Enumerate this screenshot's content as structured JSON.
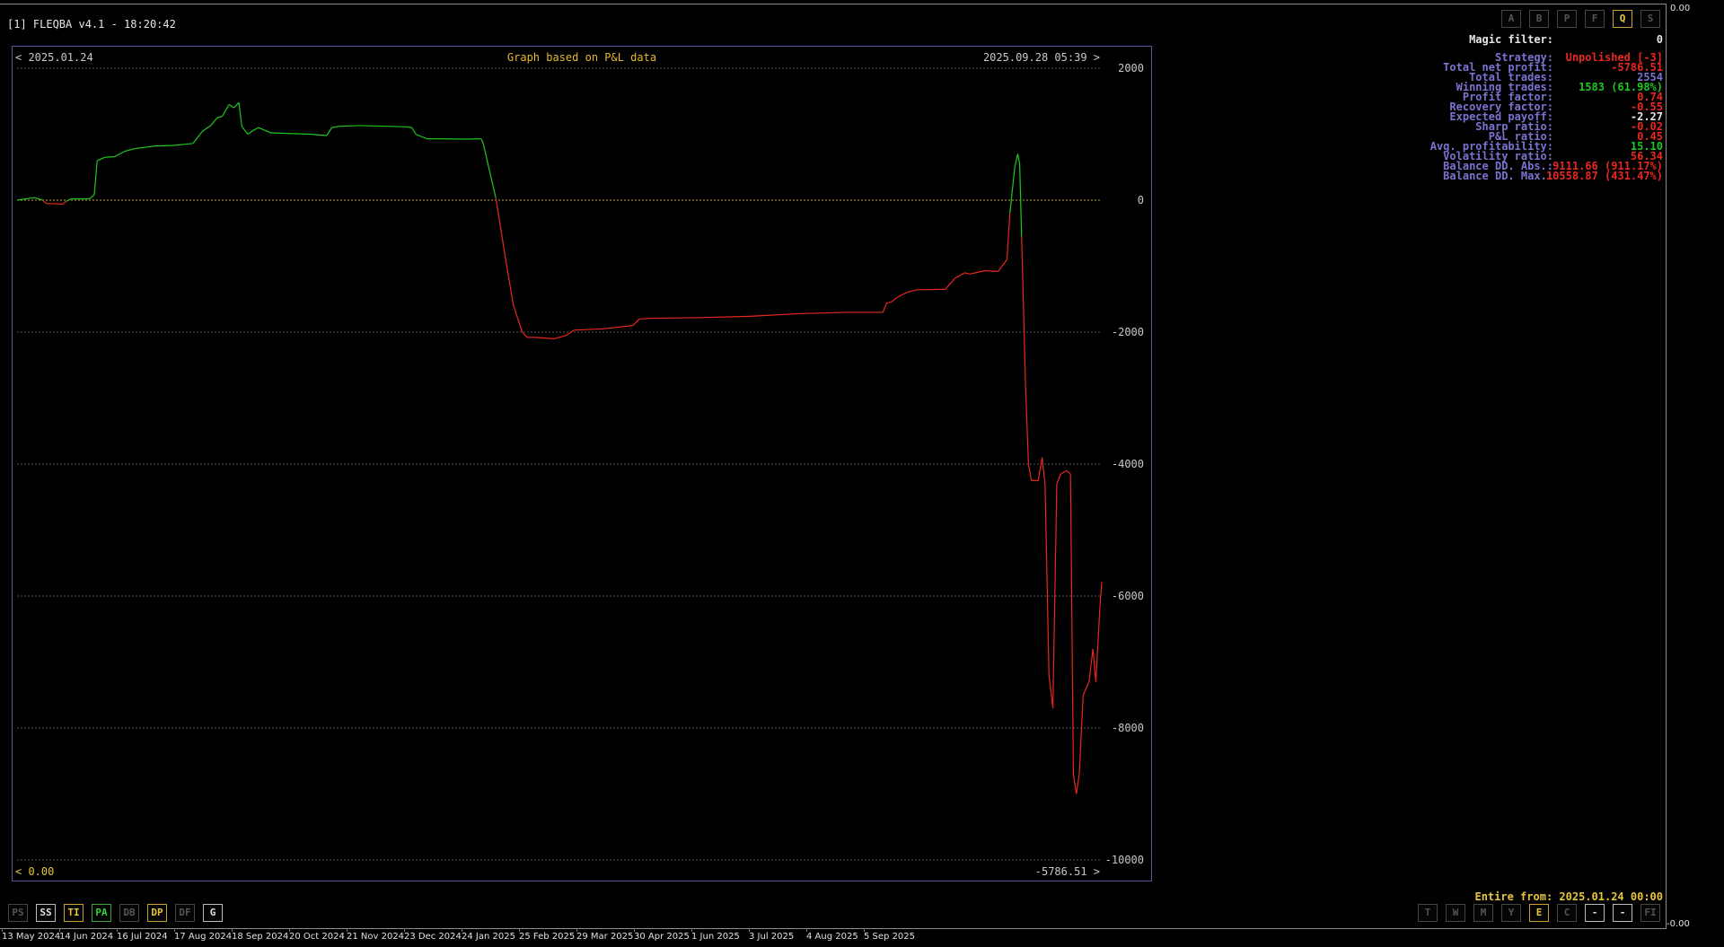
{
  "window": {
    "title": "[1] FLEQBA v4.1 - 18:20:42"
  },
  "chart_frame": {
    "start_date": "< 2025.01.24",
    "subtitle": "Graph based on P&L data",
    "end_date": "2025.09.28 05:39 >",
    "bottom_left": "< 0.00",
    "bottom_right": "-5786.51 >"
  },
  "chart_data": {
    "type": "line",
    "title": "Graph based on P&L data",
    "xlabel": "",
    "ylabel": "",
    "ylim": [
      -10000,
      2000
    ],
    "yticks": [
      2000,
      0,
      -2000,
      -4000,
      -6000,
      -8000,
      -10000
    ],
    "ytick_labels": [
      "2000",
      "0",
      "-2000",
      "-4000",
      "-6000",
      "-8000",
      "-10000"
    ],
    "grid": true,
    "positive_color": "#1ec81e",
    "negative_color": "#e8281e",
    "series": [
      {
        "values": [
          [
            0,
            0
          ],
          [
            18,
            40
          ],
          [
            26,
            0
          ],
          [
            30,
            -50
          ],
          [
            47,
            -60
          ],
          [
            50,
            -20
          ],
          [
            55,
            20
          ],
          [
            74,
            20
          ],
          [
            79,
            80
          ],
          [
            82,
            600
          ],
          [
            90,
            650
          ],
          [
            100,
            660
          ],
          [
            110,
            740
          ],
          [
            120,
            780
          ],
          [
            140,
            820
          ],
          [
            160,
            830
          ],
          [
            180,
            860
          ],
          [
            190,
            1050
          ],
          [
            198,
            1130
          ],
          [
            205,
            1250
          ],
          [
            210,
            1270
          ],
          [
            217,
            1450
          ],
          [
            222,
            1400
          ],
          [
            227,
            1480
          ],
          [
            230,
            1120
          ],
          [
            236,
            1000
          ],
          [
            241,
            1050
          ],
          [
            247,
            1100
          ],
          [
            260,
            1020
          ],
          [
            280,
            1010
          ],
          [
            300,
            1000
          ],
          [
            317,
            980
          ],
          [
            322,
            1100
          ],
          [
            330,
            1120
          ],
          [
            350,
            1130
          ],
          [
            380,
            1120
          ],
          [
            400,
            1110
          ],
          [
            404,
            1100
          ],
          [
            408,
            1000
          ],
          [
            416,
            950
          ],
          [
            420,
            930
          ],
          [
            430,
            930
          ],
          [
            460,
            925
          ],
          [
            475,
            930
          ],
          [
            477,
            860
          ],
          [
            490,
            30
          ],
          [
            500,
            -900
          ],
          [
            508,
            -1600
          ],
          [
            517,
            -2000
          ],
          [
            522,
            -2080
          ],
          [
            530,
            -2080
          ],
          [
            550,
            -2100
          ],
          [
            562,
            -2050
          ],
          [
            570,
            -1970
          ],
          [
            600,
            -1950
          ],
          [
            630,
            -1900
          ],
          [
            637,
            -1800
          ],
          [
            650,
            -1790
          ],
          [
            700,
            -1780
          ],
          [
            750,
            -1760
          ],
          [
            800,
            -1720
          ],
          [
            850,
            -1700
          ],
          [
            886,
            -1700
          ],
          [
            890,
            -1560
          ],
          [
            895,
            -1540
          ],
          [
            900,
            -1480
          ],
          [
            910,
            -1400
          ],
          [
            920,
            -1360
          ],
          [
            950,
            -1350
          ],
          [
            960,
            -1180
          ],
          [
            970,
            -1100
          ],
          [
            975,
            -1120
          ],
          [
            990,
            -1070
          ],
          [
            1004,
            -1080
          ],
          [
            1008,
            -1000
          ],
          [
            1013,
            -900
          ],
          [
            1016,
            -200
          ],
          [
            1021,
            500
          ],
          [
            1024,
            700
          ],
          [
            1026,
            550
          ],
          [
            1028,
            -550
          ],
          [
            1032,
            -2800
          ],
          [
            1035,
            -4000
          ],
          [
            1038,
            -4250
          ],
          [
            1045,
            -4250
          ],
          [
            1049,
            -3900
          ],
          [
            1052,
            -4300
          ],
          [
            1056,
            -7200
          ],
          [
            1060,
            -7700
          ],
          [
            1064,
            -4300
          ],
          [
            1068,
            -4150
          ],
          [
            1074,
            -4100
          ],
          [
            1078,
            -4150
          ],
          [
            1081,
            -8700
          ],
          [
            1084,
            -9000
          ],
          [
            1087,
            -8700
          ],
          [
            1091,
            -7500
          ],
          [
            1097,
            -7300
          ],
          [
            1101,
            -6800
          ],
          [
            1104,
            -7300
          ],
          [
            1108,
            -6200
          ],
          [
            1110,
            -5786.51
          ]
        ]
      }
    ]
  },
  "stats": {
    "magic_filter": {
      "label": "Magic filter:",
      "value": "0",
      "color": "#e6e6e6"
    },
    "rows": [
      {
        "label": "Strategy:",
        "value": "Unpolished [-3]",
        "color": "#e8281e"
      },
      {
        "label": "Total net profit:",
        "value": "-5786.51",
        "color": "#e8281e"
      },
      {
        "label": "Total trades:",
        "value": "2554",
        "color": "#7b73d1"
      },
      {
        "label": "Winning trades:",
        "value": "1583 (61.98%)",
        "color": "#1ec81e"
      },
      {
        "label": "Profit factor:",
        "value": "0.74",
        "color": "#e8281e"
      },
      {
        "label": "Recovery factor:",
        "value": "-0.55",
        "color": "#e8281e"
      },
      {
        "label": "Expected payoff:",
        "value": "-2.27",
        "color": "#e6e6e6"
      },
      {
        "label": "Sharp ratio:",
        "value": "-0.02",
        "color": "#e8281e"
      },
      {
        "label": "P&L ratio:",
        "value": "0.45",
        "color": "#e8281e"
      },
      {
        "label": "Avg. profitability:",
        "value": "15.10",
        "color": "#1ec81e"
      },
      {
        "label": "Volatility ratio:",
        "value": "56.34",
        "color": "#e8281e"
      },
      {
        "label": "Balance DD. Abs.:",
        "value": "9111.66 (911.17%)",
        "color": "#e8281e"
      },
      {
        "label": "Balance DD. Max.:",
        "value": "10558.87 (431.47%)",
        "color": "#e8281e"
      }
    ]
  },
  "top_buttons": [
    {
      "label": "A",
      "state": "off"
    },
    {
      "label": "B",
      "state": "off"
    },
    {
      "label": "P",
      "state": "off"
    },
    {
      "label": "F",
      "state": "off"
    },
    {
      "label": "Q",
      "state": "on-y"
    },
    {
      "label": "S",
      "state": "off"
    }
  ],
  "bottom_left_buttons": [
    {
      "label": "PS",
      "state": "off"
    },
    {
      "label": "SS",
      "state": "on-w"
    },
    {
      "label": "TI",
      "state": "on-y"
    },
    {
      "label": "PA",
      "state": "on-g"
    },
    {
      "label": "DB",
      "state": "off"
    },
    {
      "label": "DP",
      "state": "on-y"
    },
    {
      "label": "DF",
      "state": "off"
    },
    {
      "label": "G",
      "state": "on-w"
    }
  ],
  "bottom_right_buttons": [
    {
      "label": "T",
      "state": "off"
    },
    {
      "label": "W",
      "state": "off"
    },
    {
      "label": "M",
      "state": "off"
    },
    {
      "label": "Y",
      "state": "off"
    },
    {
      "label": "E",
      "state": "on-y"
    },
    {
      "label": "C",
      "state": "off"
    },
    {
      "label": "-",
      "state": "on-w"
    },
    {
      "label": "-",
      "state": "on-w"
    },
    {
      "label": "FI",
      "state": "off"
    }
  ],
  "entire_from": "Entire from: 2025.01.24 00:00",
  "date_axis": [
    "13 May 2024",
    "14 Jun 2024",
    "16 Jul 2024",
    "17 Aug 2024",
    "18 Sep 2024",
    "20 Oct 2024",
    "21 Nov 2024",
    "23 Dec 2024",
    "24 Jan 2025",
    "25 Feb 2025",
    "29 Mar 2025",
    "30 Apr 2025",
    "1 Jun 2025",
    "3 Jul 2025",
    "4 Aug 2025",
    "5 Sep 2025"
  ],
  "edge_values": {
    "top": "0.00",
    "bottom": "-0.00"
  }
}
